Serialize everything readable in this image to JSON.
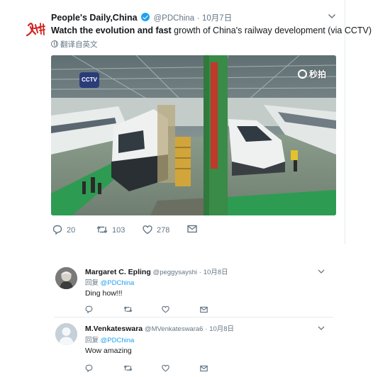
{
  "tweet": {
    "avatar_logo_text": "人民日报",
    "display_name": "People's Daily,China",
    "verified_icon": "verified-badge-icon",
    "handle": "@PDChina",
    "dot": "·",
    "time": "10月7日",
    "text_bold": "Watch the evolution and fast",
    "text_rest": " growth of China's railway development (via CCTV)",
    "translate_label": "翻译自英文",
    "media": {
      "channel_logo": "CCTV",
      "watermark": "秒拍"
    },
    "actions": {
      "reply_count": "20",
      "retweet_count": "103",
      "like_count": "278"
    },
    "colors": {
      "accent": "#1da1f2",
      "secondary_text": "#657786",
      "divider": "#e6ecf0"
    }
  },
  "replies": [
    {
      "name": "Margaret C. Epling",
      "handle": "@peggysayshi",
      "dot": "·",
      "time": "10月8日",
      "replying_label": "回复",
      "mention": "@PDChina",
      "text": "Ding how!!!"
    },
    {
      "name": "M.Venkateswara",
      "handle": "@MVenkateswara6",
      "dot": "·",
      "time": "10月8日",
      "replying_label": "回复",
      "mention": "@PDChina",
      "text": "Wow amazing"
    }
  ]
}
